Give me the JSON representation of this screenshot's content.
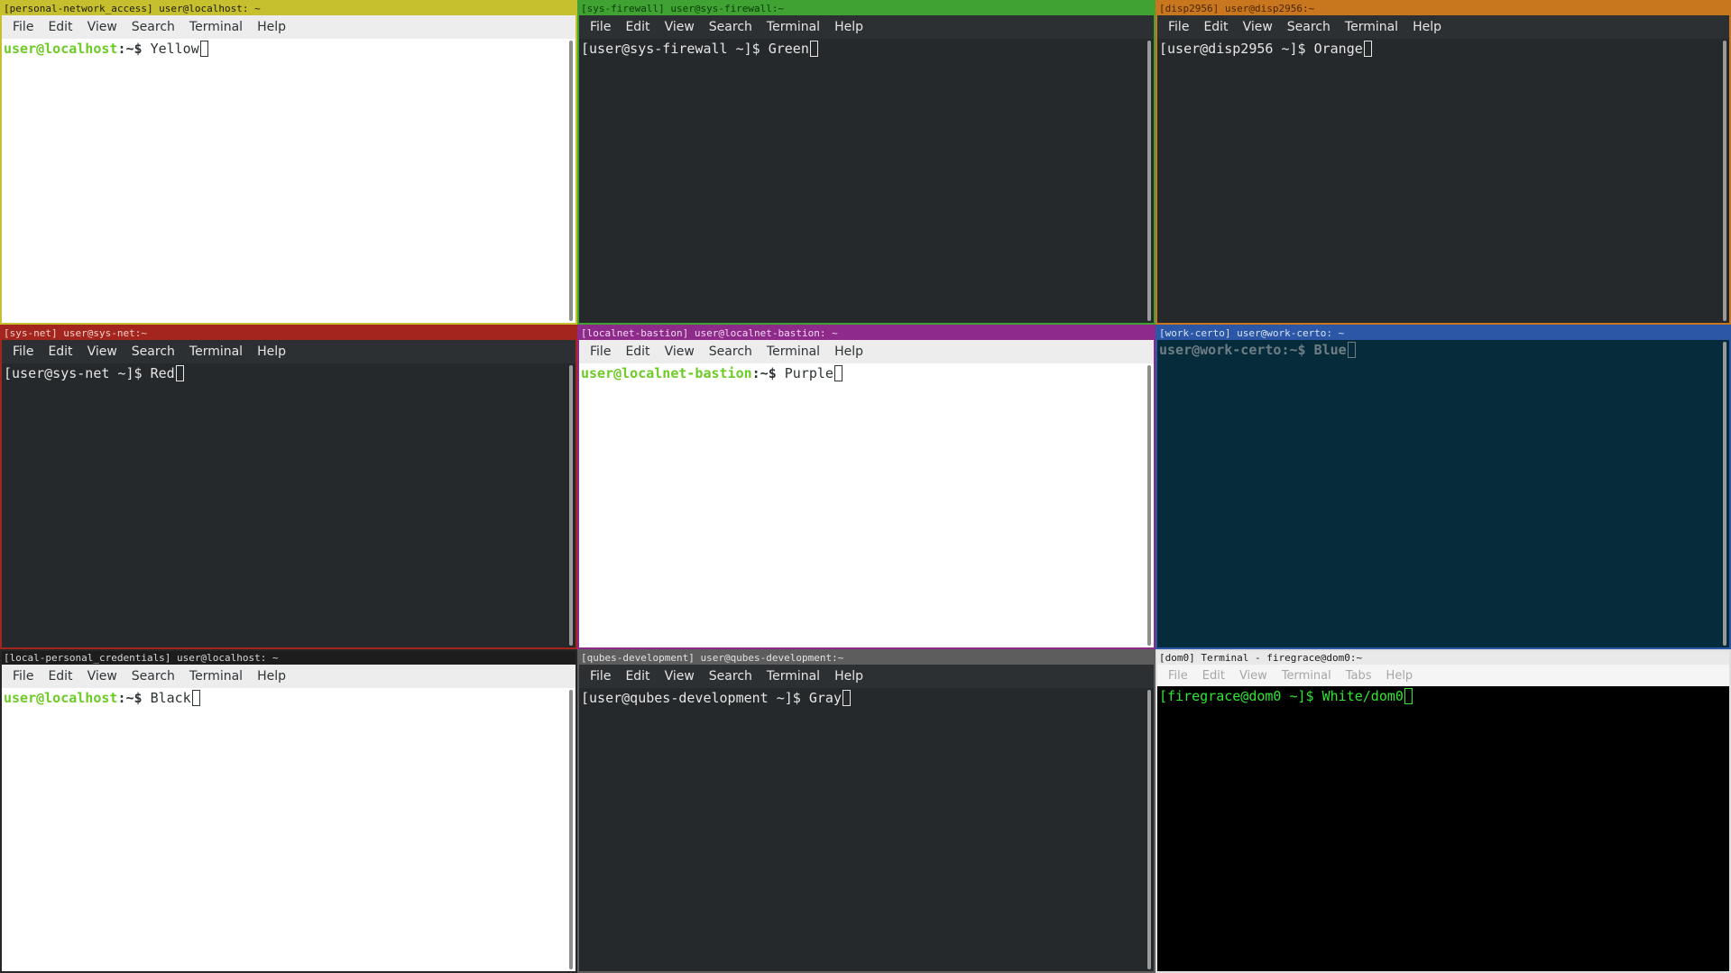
{
  "windows": [
    {
      "title": "[personal-network_access] user@localhost: ~",
      "menu": [
        "File",
        "Edit",
        "View",
        "Search",
        "Terminal",
        "Help"
      ],
      "prompt_user": "user@localhost",
      "prompt_rest": ":~$ ",
      "command": "Yellow",
      "colors": {
        "border": "#c6c02f",
        "title_bg": "#c6c02f",
        "title_fg": "#1b1b00",
        "menu_bg": "#ededed",
        "menu_fg": "#2e3436",
        "term_bg": "#ffffff",
        "term_fg": "#2e3436",
        "prompt_user_color": "#6ccb24"
      }
    },
    {
      "title": "[sys-firewall] user@sys-firewall:~",
      "menu": [
        "File",
        "Edit",
        "View",
        "Search",
        "Terminal",
        "Help"
      ],
      "prompt_user": "",
      "prompt_rest": "[user@sys-firewall ~]$ ",
      "command": "Green",
      "colors": {
        "border": "#3fa233",
        "title_bg": "#3fa233",
        "title_fg": "#0c3a08",
        "menu_bg": "#2d3033",
        "menu_fg": "#e6e6e6",
        "term_bg": "#25292c",
        "term_fg": "#e6e6e6",
        "prompt_user_color": "#e6e6e6"
      }
    },
    {
      "title": "[disp2956] user@disp2956:~",
      "menu": [
        "File",
        "Edit",
        "View",
        "Search",
        "Terminal",
        "Help"
      ],
      "prompt_user": "",
      "prompt_rest": "[user@disp2956 ~]$ ",
      "command": "Orange",
      "colors": {
        "border": "#c9771e",
        "title_bg": "#c9771e",
        "title_fg": "#4a2600",
        "menu_bg": "#2d3033",
        "menu_fg": "#e6e6e6",
        "term_bg": "#25292c",
        "term_fg": "#e6e6e6",
        "prompt_user_color": "#e6e6e6"
      }
    },
    {
      "title": "[sys-net] user@sys-net:~",
      "menu": [
        "File",
        "Edit",
        "View",
        "Search",
        "Terminal",
        "Help"
      ],
      "prompt_user": "",
      "prompt_rest": "[user@sys-net ~]$ ",
      "command": "Red",
      "colors": {
        "border": "#a3251e",
        "title_bg": "#a3251e",
        "title_fg": "#f2d0cc",
        "menu_bg": "#2d3033",
        "menu_fg": "#e6e6e6",
        "term_bg": "#25292c",
        "term_fg": "#e6e6e6",
        "prompt_user_color": "#e6e6e6"
      }
    },
    {
      "title": "[localnet-bastion] user@localnet-bastion: ~",
      "menu": [
        "File",
        "Edit",
        "View",
        "Search",
        "Terminal",
        "Help"
      ],
      "prompt_user": "user@localnet-bastion",
      "prompt_rest": ":~$ ",
      "command": "Purple",
      "colors": {
        "border": "#8e2a8a",
        "title_bg": "#8e2a8a",
        "title_fg": "#f3d9f1",
        "menu_bg": "#ededed",
        "menu_fg": "#2e3436",
        "term_bg": "#ffffff",
        "term_fg": "#2e3436",
        "prompt_user_color": "#6ccb24"
      }
    },
    {
      "title": "[work-certo] user@work-certo: ~",
      "menu": [],
      "prompt_user": "user@work-certo",
      "prompt_rest": ":~$ ",
      "command": "Blue",
      "colors": {
        "border": "#2b57a6",
        "title_bg": "#2b57a6",
        "title_fg": "#d7e2f6",
        "menu_bg": "#062c3b",
        "menu_fg": "#8a9aa2",
        "term_bg": "#062c3b",
        "term_fg": "#6f7e85",
        "prompt_user_color": "#6f7e85"
      }
    },
    {
      "title": "[local-personal_credentials] user@localhost: ~",
      "menu": [
        "File",
        "Edit",
        "View",
        "Search",
        "Terminal",
        "Help"
      ],
      "prompt_user": "user@localhost",
      "prompt_rest": ":~$ ",
      "command": "Black",
      "colors": {
        "border": "#262626",
        "title_bg": "#1d1d1d",
        "title_fg": "#d8d8d8",
        "menu_bg": "#ededed",
        "menu_fg": "#2e3436",
        "term_bg": "#ffffff",
        "term_fg": "#2e3436",
        "prompt_user_color": "#6ccb24"
      }
    },
    {
      "title": "[qubes-development] user@qubes-development:~",
      "menu": [
        "File",
        "Edit",
        "View",
        "Search",
        "Terminal",
        "Help"
      ],
      "prompt_user": "",
      "prompt_rest": "[user@qubes-development ~]$ ",
      "command": "Gray",
      "colors": {
        "border": "#5d5d5d",
        "title_bg": "#5d5d5d",
        "title_fg": "#e2e2e2",
        "menu_bg": "#2d3033",
        "menu_fg": "#e6e6e6",
        "term_bg": "#25292c",
        "term_fg": "#e6e6e6",
        "prompt_user_color": "#e6e6e6"
      }
    },
    {
      "title": "[dom0] Terminal - firegrace@dom0:~",
      "menu": [
        "File",
        "Edit",
        "View",
        "Terminal",
        "Tabs",
        "Help"
      ],
      "prompt_user": "",
      "prompt_rest": "[firegrace@dom0 ~]$ ",
      "command": "White/dom0",
      "colors": {
        "border": "#e0e0e0",
        "title_bg": "#e9e9e9",
        "title_fg": "#1b1b1b",
        "menu_bg": "#f5f5f5",
        "menu_fg": "#a6a6a6",
        "term_bg": "#000000",
        "term_fg": "#2ee62e",
        "prompt_user_color": "#2ee62e"
      }
    }
  ]
}
